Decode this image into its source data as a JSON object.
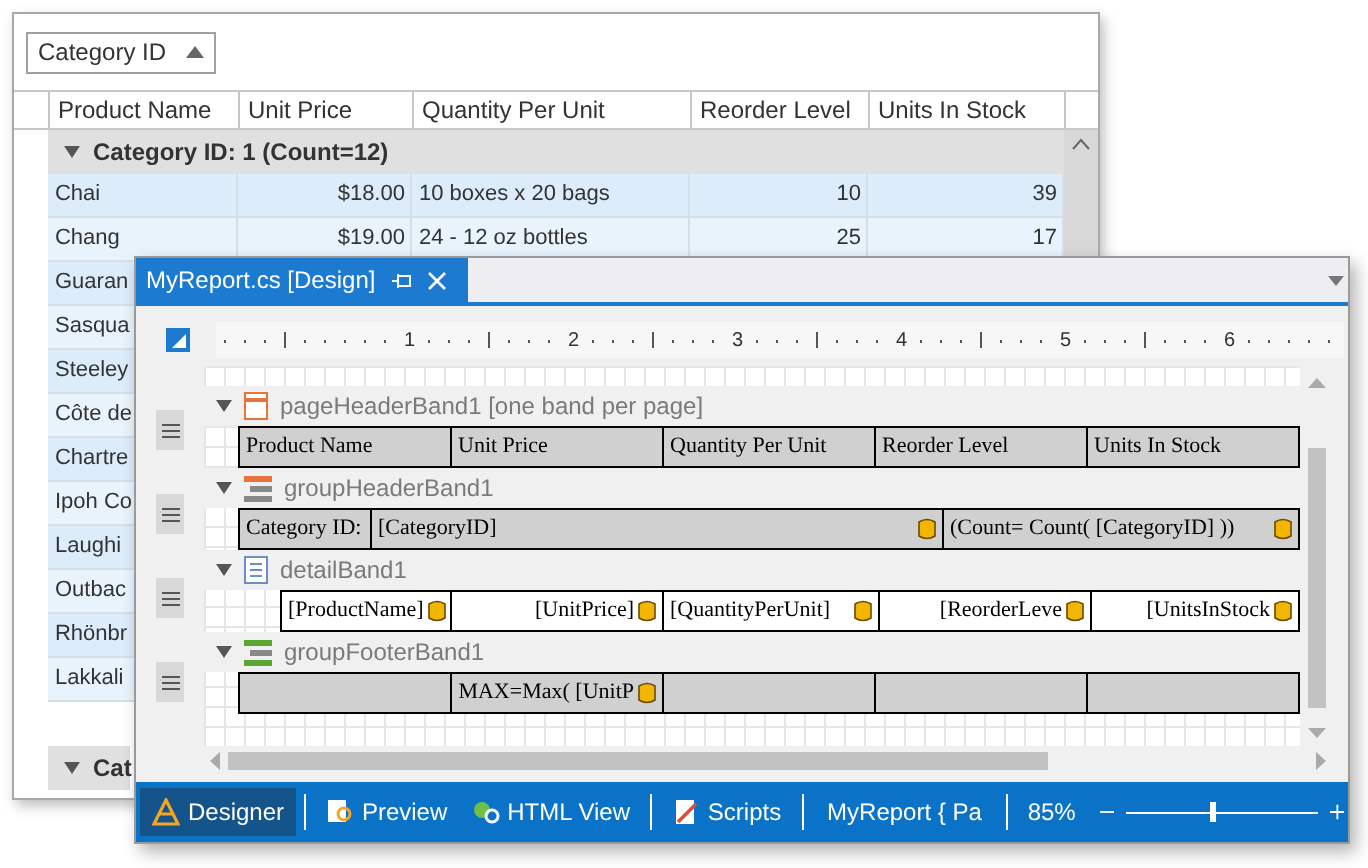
{
  "grid": {
    "group_chip": "Category ID",
    "columns": [
      "Product Name",
      "Unit Price",
      "Quantity Per Unit",
      "Reorder Level",
      "Units In Stock"
    ],
    "group": {
      "label": "Category ID: 1 (Count=12)",
      "expanded": true
    },
    "rows": [
      {
        "cells": [
          "Chai",
          "$18.00",
          "10 boxes x 20 bags",
          "10",
          "39"
        ]
      },
      {
        "cells": [
          "Chang",
          "$19.00",
          "24 - 12 oz bottles",
          "25",
          "17"
        ]
      },
      {
        "cells": [
          "Guaran"
        ]
      },
      {
        "cells": [
          "Sasqua"
        ]
      },
      {
        "cells": [
          "Steeley"
        ]
      },
      {
        "cells": [
          "Côte de"
        ]
      },
      {
        "cells": [
          "Chartre"
        ]
      },
      {
        "cells": [
          "Ipoh Co"
        ]
      },
      {
        "cells": [
          "Laughi"
        ]
      },
      {
        "cells": [
          "Outbac"
        ]
      },
      {
        "cells": [
          "Rhönbr"
        ]
      },
      {
        "cells": [
          "Lakkali"
        ]
      }
    ],
    "next_group": {
      "label": "Cat",
      "expanded": true
    }
  },
  "designer": {
    "title": "MyReport.cs [Design]",
    "ruler": [
      "1",
      "2",
      "3",
      "4",
      "5",
      "6"
    ],
    "bands": [
      {
        "kind": "page-header",
        "name": "pageHeaderBand1",
        "note": "[one band per page]",
        "expanded": true,
        "cells": [
          {
            "text": "Product Name"
          },
          {
            "text": "Unit Price"
          },
          {
            "text": "Quantity Per Unit"
          },
          {
            "text": "Reorder Level"
          },
          {
            "text": "Units In Stock"
          }
        ]
      },
      {
        "kind": "group-header",
        "name": "groupHeaderBand1",
        "expanded": true,
        "cells": [
          {
            "text": "Category ID:"
          },
          {
            "text": "[CategoryID]",
            "bound": true
          },
          {
            "text": "(Count= Count( [CategoryID] ))",
            "bound": true
          }
        ]
      },
      {
        "kind": "detail",
        "name": "detailBand1",
        "expanded": true,
        "cells": [
          {
            "text": "[ProductName]",
            "bound": true
          },
          {
            "text": "[UnitPrice]",
            "bound": true
          },
          {
            "text": "[QuantityPerUnit]",
            "bound": true
          },
          {
            "text": "[ReorderLeve",
            "bound": true
          },
          {
            "text": "[UnitsInStock",
            "bound": true
          }
        ]
      },
      {
        "kind": "group-footer",
        "name": "groupFooterBand1",
        "expanded": true,
        "cells": [
          {},
          {
            "text": "MAX=Max( [UnitP",
            "bound": true
          },
          {},
          {},
          {}
        ]
      }
    ]
  },
  "status_bar": {
    "tabs": [
      {
        "label": "Designer",
        "selected": true
      },
      {
        "label": "Preview",
        "selected": false
      },
      {
        "label": "HTML View",
        "selected": false
      },
      {
        "label": "Scripts",
        "selected": false
      }
    ],
    "report_name": "MyReport { Pa",
    "zoom": {
      "reading": "85%",
      "level": 0.45
    }
  }
}
